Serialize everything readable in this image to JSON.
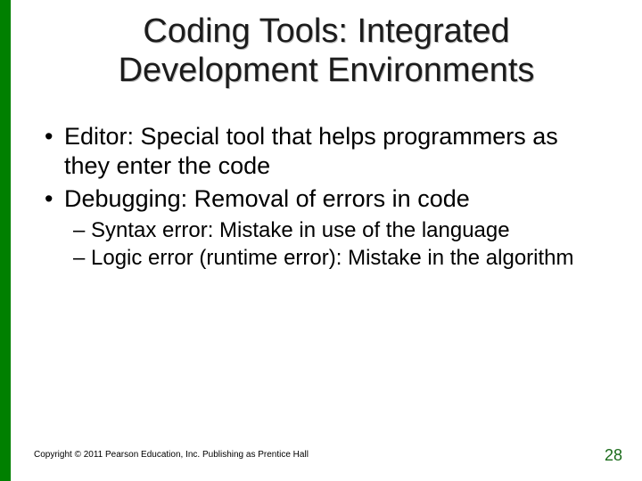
{
  "title_line1": "Coding Tools: Integrated",
  "title_line2": "Development Environments",
  "bullets": {
    "b1": "Editor: Special tool that helps programmers as they enter the code",
    "b2": "Debugging: Removal of errors in code",
    "s1": "Syntax error: Mistake in use of the language",
    "s2": "Logic error (runtime error): Mistake in the algorithm"
  },
  "copyright": "Copyright © 2011 Pearson Education, Inc. Publishing as Prentice Hall",
  "page_number": "28"
}
